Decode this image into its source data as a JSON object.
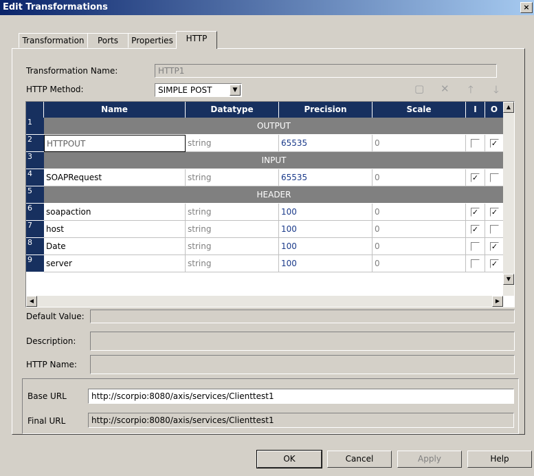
{
  "window": {
    "title": "Edit Transformations",
    "close": "×"
  },
  "tabs": [
    "Transformation",
    "Ports",
    "Properties",
    "HTTP"
  ],
  "form": {
    "name_label": "Transformation Name:",
    "name_value": "HTTP1",
    "method_label": "HTTP Method:",
    "method_value": "SIMPLE POST"
  },
  "grid": {
    "columns": [
      "Name",
      "Datatype",
      "Precision",
      "Scale",
      "I",
      "O"
    ],
    "rows": [
      {
        "num": "1",
        "section": "OUTPUT"
      },
      {
        "num": "2",
        "name": "HTTPOUT",
        "datatype": "string",
        "precision": "65535",
        "scale": "0",
        "i": false,
        "o": true
      },
      {
        "num": "3",
        "section": "INPUT"
      },
      {
        "num": "4",
        "name": "SOAPRequest",
        "datatype": "string",
        "precision": "65535",
        "scale": "0",
        "i": true,
        "o": false
      },
      {
        "num": "5",
        "section": "HEADER"
      },
      {
        "num": "6",
        "name": "soapaction",
        "datatype": "string",
        "precision": "100",
        "scale": "0",
        "i": true,
        "o": true
      },
      {
        "num": "7",
        "name": "host",
        "datatype": "string",
        "precision": "100",
        "scale": "0",
        "i": true,
        "o": false
      },
      {
        "num": "8",
        "name": "Date",
        "datatype": "string",
        "precision": "100",
        "scale": "0",
        "i": false,
        "o": true
      },
      {
        "num": "9",
        "name": "server",
        "datatype": "string",
        "precision": "100",
        "scale": "0",
        "i": false,
        "o": true
      }
    ]
  },
  "props": {
    "default_label": "Default Value:",
    "description_label": "Description:",
    "http_name_label": "HTTP Name:"
  },
  "urls": {
    "base_label": "Base URL",
    "base_value": "http://scorpio:8080/axis/services/Clienttest1",
    "final_label": "Final URL",
    "final_value": "http://scorpio:8080/axis/services/Clienttest1"
  },
  "buttons": {
    "ok": "OK",
    "cancel": "Cancel",
    "apply": "Apply",
    "help": "Help"
  },
  "colors": {
    "header": "#17305f",
    "section": "#808080",
    "precision_text": "#1a3a8a"
  }
}
